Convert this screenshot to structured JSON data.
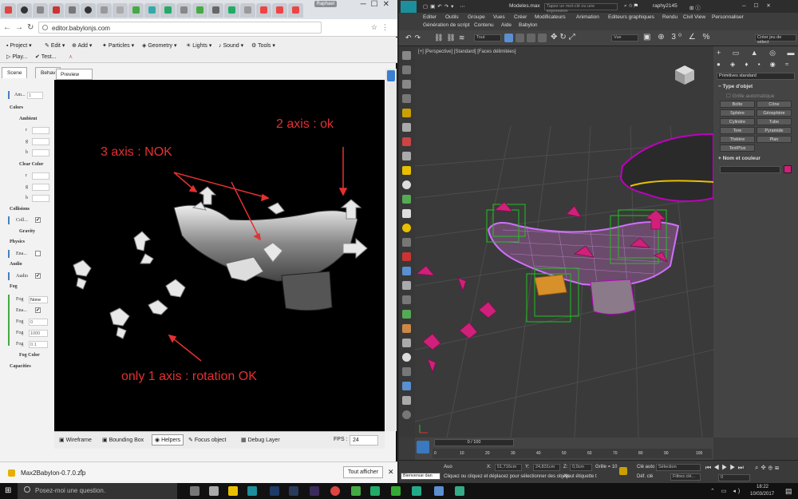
{
  "browser": {
    "tab_pill": "Raphael",
    "url": "editor.babylonjs.com",
    "menu": {
      "project": "Project",
      "edit": "Edit",
      "add": "Add",
      "particles": "Particles",
      "geometry": "Geometry",
      "lights": "Lights",
      "sound": "Sound",
      "tools": "Tools",
      "play": "Play...",
      "test": "Test..."
    },
    "panel_tabs": [
      "Scene",
      "Behav"
    ],
    "preview_tab": "Preview",
    "props": {
      "ambient_label": "Am...",
      "ambient_value": "1",
      "colors": "Colors",
      "ambient": "Ambient",
      "r": "r",
      "g": "g",
      "b": "b",
      "clear_color": "Clear Color",
      "collisions": "Collisions",
      "coll": "Coll...",
      "gravity": "Gravity",
      "physics": "Physics",
      "ena": "Ena...",
      "audio": "Audio",
      "audio_item": "Audio",
      "fog": "Fog",
      "fog_mode_label": "Fog",
      "fog_mode_value": "None",
      "fog_enabled": "Ena...",
      "fog_start_label": "Fog",
      "fog_start": "0",
      "fog_end_label": "Fog",
      "fog_end": "1000",
      "fog_density_label": "Fog",
      "fog_density": "0.1",
      "fog_color": "Fog Color",
      "capacities": "Capacities"
    },
    "annotations": {
      "three_axis": "3 axis : NOK",
      "two_axis": "2 axis : ok",
      "one_axis": "only 1 axis : rotation OK"
    },
    "bottom": {
      "wireframe": "Wireframe",
      "bounding_box": "Bounding Box",
      "helpers": "Helpers",
      "focus_object": "Focus object",
      "debug_layer": "Debug Layer",
      "fps_label": "FPS :",
      "fps_value": "24"
    },
    "download": {
      "file": "Max2Babylon-0.7.0.zip",
      "show_all": "Tout afficher"
    }
  },
  "max": {
    "logo": "MAX",
    "title": "Modeles.max",
    "search_placeholder": "Tapez un mot-clé ou une expression",
    "user": "raphy2145",
    "menu_row1": [
      "Editer",
      "Outils",
      "Groupe",
      "Vues",
      "Créer",
      "Modificateurs",
      "Animation",
      "Editeurs graphiques",
      "Rendu",
      "Civil View",
      "Personnaliser"
    ],
    "menu_row2": [
      "Génération de script",
      "Contenu",
      "Aide",
      "Babylon"
    ],
    "toolbar": {
      "selection_filter": "Tout",
      "view": "Vue",
      "selection_set": "Créer jeu de sélect"
    },
    "viewport_label": "[+] [Perspective] [Standard] [Faces délimitées]",
    "command_panel": {
      "dropdown": "Primitives standard",
      "object_type": "Type d'objet",
      "autogrid": "Grille automatique",
      "buttons": [
        "Boîte",
        "Cône",
        "Sphère",
        "Géosphère",
        "Cylindre",
        "Tube",
        "Tore",
        "Pyramide",
        "Théière",
        "Plan",
        "TextPlus"
      ],
      "name_color": "Nom et couleur"
    },
    "timeline": {
      "frame": "0 / 100",
      "ticks": [
        "0",
        "10",
        "20",
        "30",
        "40",
        "50",
        "60",
        "70",
        "80",
        "90",
        "100"
      ]
    },
    "status": {
      "welcome": "Bienvenue dan",
      "prompt": "Cliquez ou cliquez et déplacez pour sélectionner des objets",
      "add_tag": "Ajout étiquette t",
      "auto": "Auo",
      "x_label": "X:",
      "x_value": "51,716cm",
      "y_label": "Y:",
      "y_value": "24,831cm",
      "z_label": "Z:",
      "z_value": "0,0cm",
      "grid": "Grille = 10",
      "key_auto": "Clé auto",
      "selection": "Sélection",
      "set_key": "Déf. clé",
      "key_filters": "Filtres clé...",
      "frame_value": "0"
    }
  },
  "taskbar": {
    "search": "Posez-moi une question.",
    "time": "18:22",
    "date": "10/03/2017"
  }
}
